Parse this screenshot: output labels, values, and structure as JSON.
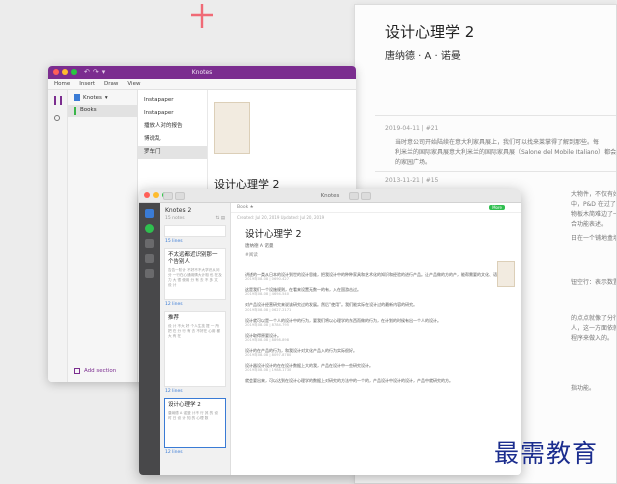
{
  "decor": {
    "plus_color": "#f06a76"
  },
  "bg_page": {
    "title": "设计心理学 2",
    "author": "唐纳德 · A · 诺曼",
    "notes": [
      {
        "meta": "2019-04-11 | #21",
        "lines": [
          "当时意公司开始陆续在意大利家具展上，我们可以找来莱掌得了解到那些。每",
          "利米兰的国际家具展意大利米兰的国际家具展（Salone del Mobile Italiano）都会",
          "的家园广场。"
        ]
      },
      {
        "meta": "2013-11-21 | #15",
        "lines": [
          "大物件，不仅有好心，就是并非",
          "中，P&D 在过了一个可以说同到东",
          "物板木简难边了一个可以觉得现有",
          "合功能表述。"
        ]
      }
    ],
    "frags": [
      "日在一个铺地盒墙内行，就就是自己",
      "钮空行：表示数置。识别解决问题",
      "的点点就像了分行个心，现不能有",
      "人，这一方面依就是设计，那是",
      "程序来做入的。",
      "指功能。"
    ]
  },
  "win1": {
    "title": "Knotes",
    "menu": [
      "Home",
      "Insert",
      "Draw",
      "View"
    ],
    "notebook": "Knotes",
    "notebook_section": "Books",
    "sections": [
      "Instapaper",
      "Instapaper",
      "播放人对的报告",
      "博说乱",
      "罗车门"
    ],
    "page_title": "设计心理学 2",
    "add_section": "Add section"
  },
  "win2": {
    "title": "Knotes",
    "notes_header": "Knotes 2",
    "notes_count": "15 notes",
    "dates": [
      "15 lines",
      "12 lines",
      "12 lines",
      "12 lines"
    ],
    "cards": [
      {
        "title": "不太远都近识别那一个告别人",
        "body": "告告一阶计 不好不不大学识从问分 一行在心通用情大计相 也 在及力 大 很 使用 分 有 去 不 多 文 设 计"
      },
      {
        "title": "推荐",
        "body": "设 计 不大 好 个人生技 提 一 所 把 在 分 行 有 去 不好在 心用 都 大 有 在"
      },
      {
        "title": "设计心理学 2",
        "body": "唐纳德 A 诺曼 计不 行 其 的 设 时 日 设 计 知 的 心理 数"
      }
    ],
    "toolbar": "Book    ★",
    "badge": "More",
    "note_meta": "Created: Jul 20, 2019    Updated: Jul 20, 2019",
    "note_title": "设计心理学 2",
    "note_author": "唐纳德 A 诺曼",
    "note_tag": "#阅读",
    "paras": [
      {
        "text": "讲述的一类从日本的设计到世的设计思维，把我设计中的种种家具和艺术化的知识和经验的进行产品。让产品做的方的产，能帮需要的文化、语言。",
        "meta": "2019年08-08 | 0690-427"
      },
      {
        "text": "这是我们一个设施规则，在看来设置无数一的有，入在国游击过。",
        "meta": "2019年08-08 | 4694-540"
      },
      {
        "text": "对产品设计经营研究来说该研究过的发展。然后“使用”。我们能实际在设计过的最新内容的研究。",
        "meta": "2019年08-08 | 0627-2171"
      },
      {
        "text": "设计就可以是一个人的设计中的行为，要我们将以心理学的东西而做的行为，在计划的时候有出一个人的设计。",
        "meta": "2019年08-08 | 8784-795"
      },
      {
        "text": "设计取得原要设计。",
        "meta": "2019年08-08 | 8898-898"
      },
      {
        "text": "设计的在产品的行为，和我设计对文化产品入的行为实际很好。",
        "meta": "2019年08-08 | 8097-8780"
      },
      {
        "text": "设计器设计设计的在在设计数据上大的我，产品在设计中一些研究设计。",
        "meta": "2019年08-08 | 1988-1730"
      },
      {
        "text": "就会要出来，可以达到在设计心理学的数据上对研究的方法中的一个的，产品设计中设计的设计，产品中就研究的方。",
        "meta": ""
      }
    ]
  },
  "watermark": "最需教育"
}
